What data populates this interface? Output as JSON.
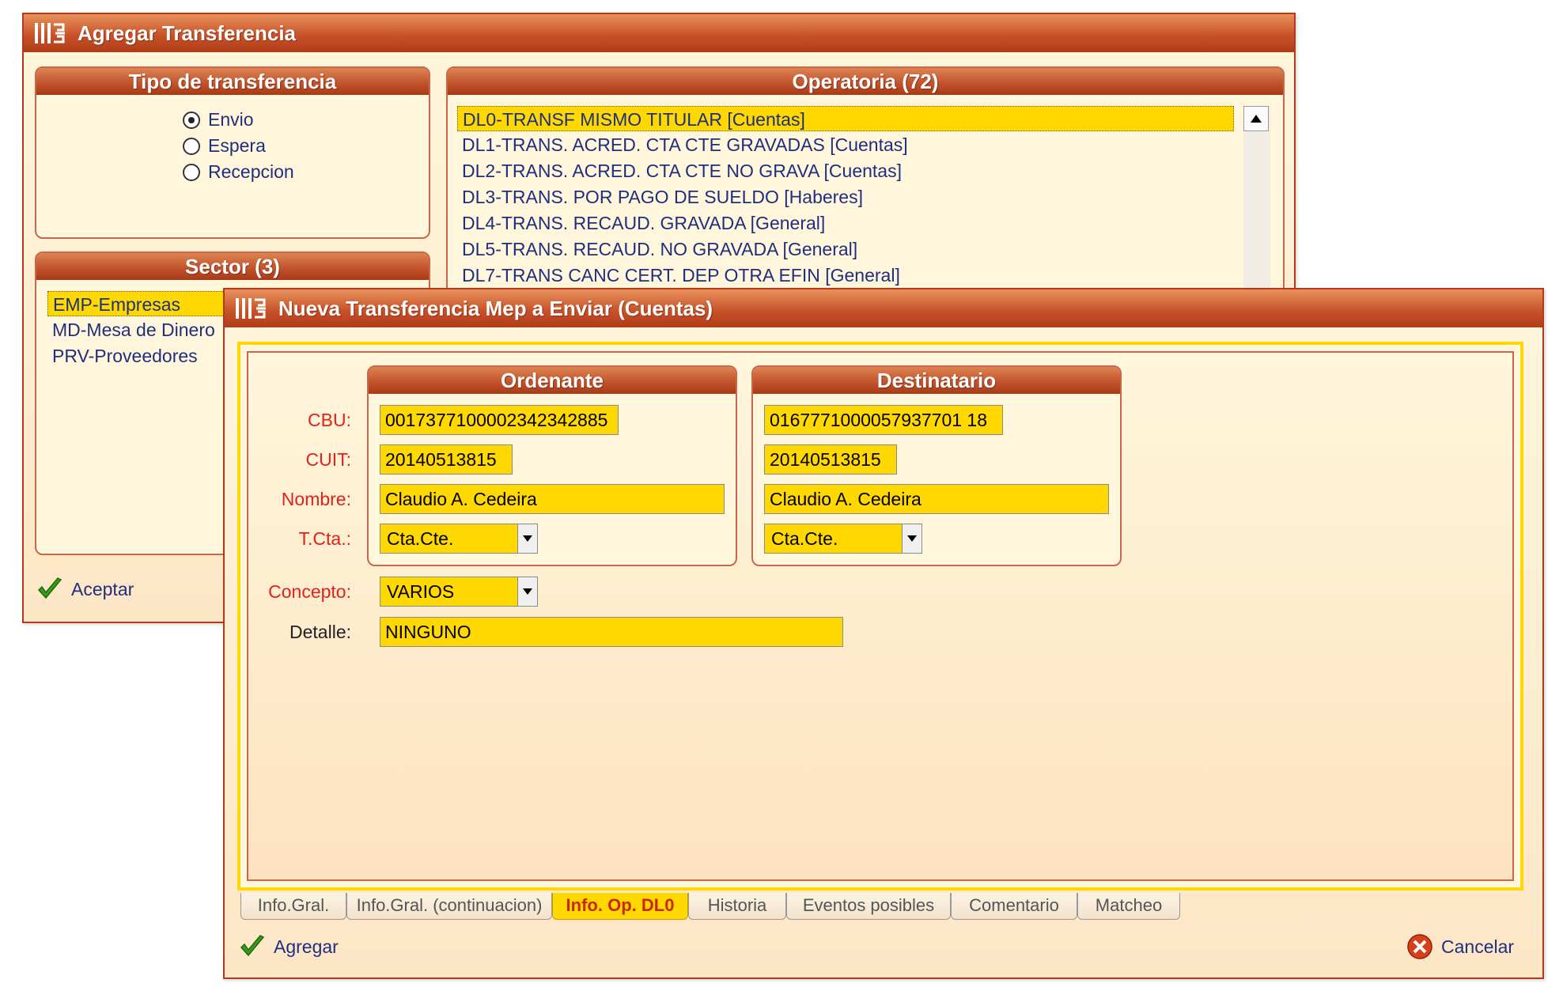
{
  "back_window": {
    "title": "Agregar Transferencia",
    "tipo": {
      "title": "Tipo de transferencia",
      "options": [
        "Envio",
        "Espera",
        "Recepcion"
      ],
      "selected": "Envio"
    },
    "sector": {
      "title": "Sector (3)",
      "items": [
        "EMP-Empresas",
        "MD-Mesa de Dinero",
        "PRV-Proveedores"
      ]
    },
    "operatoria": {
      "title": "Operatoria (72)",
      "items": [
        "DL0-TRANSF MISMO TITULAR [Cuentas]",
        "DL1-TRANS. ACRED. CTA CTE GRAVADAS [Cuentas]",
        "DL2-TRANS. ACRED. CTA CTE NO GRAVA [Cuentas]",
        "DL3-TRANS. POR PAGO DE SUELDO [Haberes]",
        "DL4-TRANS. RECAUD. GRAVADA [General]",
        "DL5-TRANS. RECAUD. NO GRAVADA [General]",
        "DL7-TRANS CANC CERT. DEP OTRA EFIN [General]"
      ]
    },
    "aceptar_label": "Aceptar"
  },
  "front_window": {
    "title": "Nueva Transferencia Mep a Enviar (Cuentas)",
    "labels": {
      "cbu": "CBU:",
      "cuit": "CUIT:",
      "nombre": "Nombre:",
      "tcta": "T.Cta.:",
      "concepto": "Concepto:",
      "detalle": "Detalle:"
    },
    "ordenante": {
      "title": "Ordenante",
      "cbu": "0017377100002342342885",
      "cuit": "20140513815",
      "nombre": "Claudio A. Cedeira",
      "tcta": "Cta.Cte."
    },
    "destinatario": {
      "title": "Destinatario",
      "cbu": "0167771000057937701 18",
      "cuit": "20140513815",
      "nombre": "Claudio A. Cedeira",
      "tcta": "Cta.Cte."
    },
    "concepto": "VARIOS",
    "detalle": "NINGUNO",
    "tabs": [
      "Info.Gral.",
      "Info.Gral. (continuacion)",
      "Info. Op. DL0",
      "Historia",
      "Eventos posibles",
      "Comentario",
      "Matcheo"
    ],
    "active_tab": "Info. Op. DL0",
    "agregar_label": "Agregar",
    "cancelar_label": "Cancelar"
  },
  "colors": {
    "title_bar": "#c8532a",
    "field_bg": "#ffd800",
    "required_label": "#e0221b",
    "link_text": "#1f2f80"
  },
  "icons": {
    "app_logo": "app-logo-icon",
    "accept": "green-check-icon",
    "cancel": "red-cancel-icon",
    "scroll_up": "scroll-up-arrow-icon",
    "dropdown": "chevron-down-icon"
  }
}
